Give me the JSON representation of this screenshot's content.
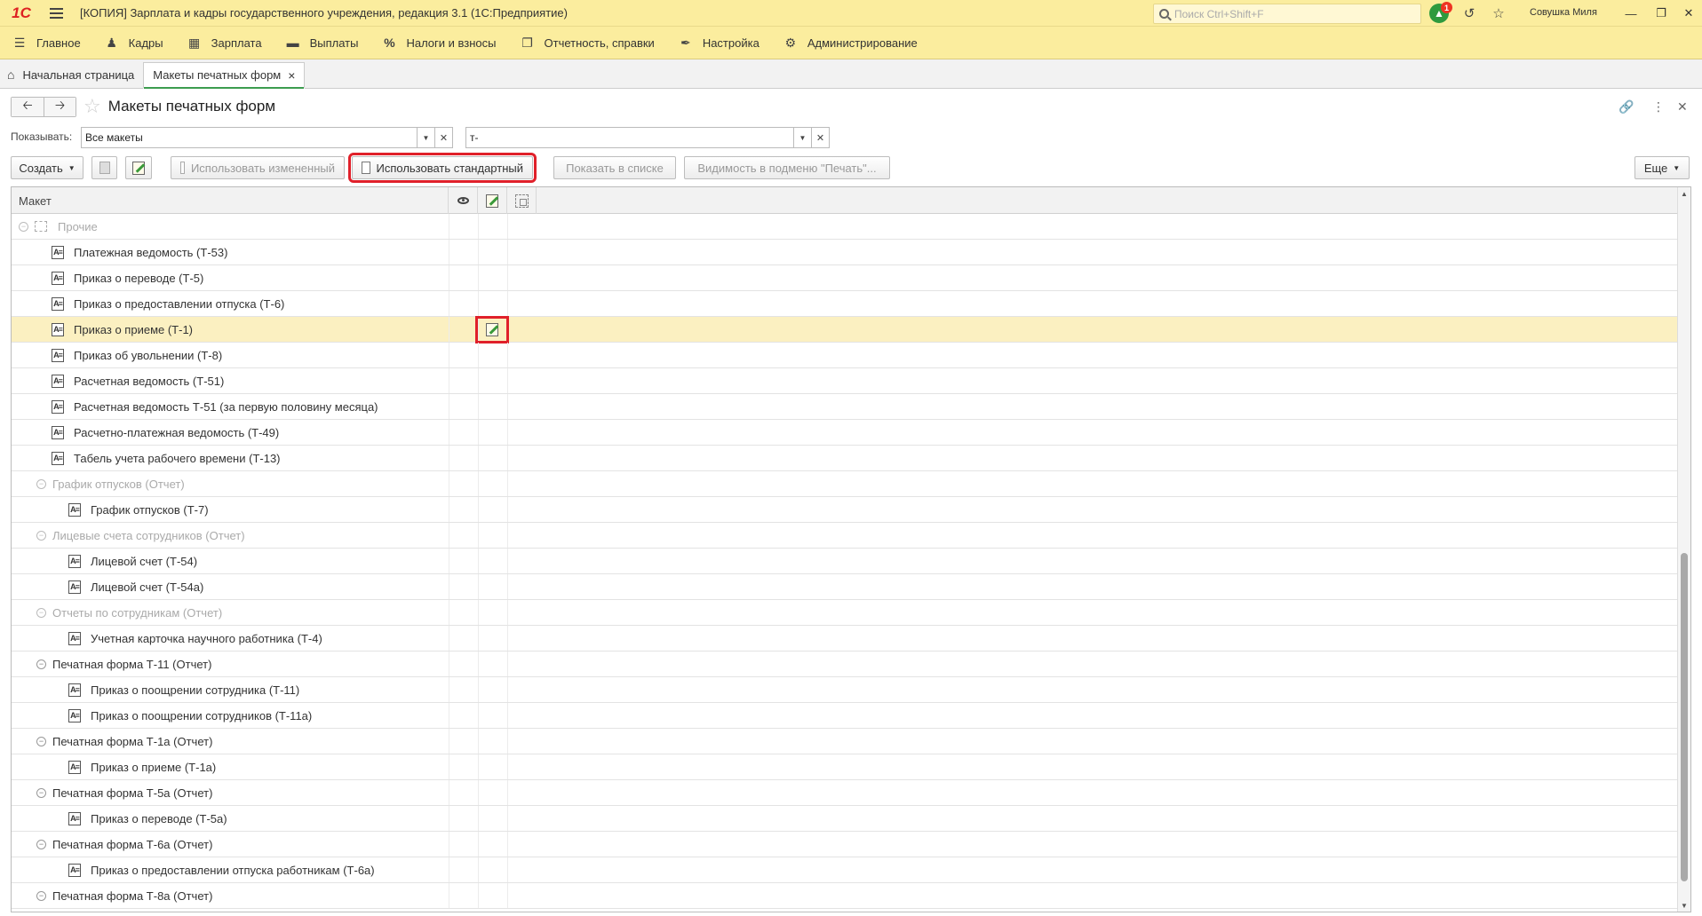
{
  "titlebar": {
    "logo": "1С",
    "title": "[КОПИЯ] Зарплата и кадры государственного учреждения, редакция 3.1  (1С:Предприятие)",
    "search_placeholder": "Поиск Ctrl+Shift+F",
    "notification_count": "1",
    "user": "Совушка Миля"
  },
  "menu": [
    {
      "label": "Главное",
      "icon": "list-icon"
    },
    {
      "label": "Кадры",
      "icon": "people-icon"
    },
    {
      "label": "Зарплата",
      "icon": "calculator-icon"
    },
    {
      "label": "Выплаты",
      "icon": "wallet-icon"
    },
    {
      "label": "Налоги и взносы",
      "icon": "percent-icon"
    },
    {
      "label": "Отчетность, справки",
      "icon": "reports-icon"
    },
    {
      "label": "Настройка",
      "icon": "wrench-icon"
    },
    {
      "label": "Администрирование",
      "icon": "gear-icon"
    }
  ],
  "tabs": {
    "home": "Начальная страница",
    "active": "Макеты печатных форм"
  },
  "form": {
    "title": "Макеты печатных форм",
    "show_label": "Показывать:",
    "show_value": "Все макеты",
    "search_value": "т-"
  },
  "toolbar": {
    "create": "Создать",
    "use_changed": "Использовать измененный",
    "use_standard": "Использовать стандартный",
    "show_in_list": "Показать в списке",
    "visibility": "Видимость в подменю \"Печать\"...",
    "more": "Еще"
  },
  "grid": {
    "column_header": "Макет",
    "rows": [
      {
        "label": "Прочие",
        "level": 0,
        "kind": "root"
      },
      {
        "label": "Платежная ведомость (Т-53)",
        "level": 1,
        "kind": "item"
      },
      {
        "label": "Приказ о переводе (Т-5)",
        "level": 1,
        "kind": "item"
      },
      {
        "label": "Приказ о предоставлении отпуска (Т-6)",
        "level": 1,
        "kind": "item"
      },
      {
        "label": "Приказ о приеме (Т-1)",
        "level": 1,
        "kind": "item",
        "selected": true,
        "edited": true
      },
      {
        "label": "Приказ об увольнении (Т-8)",
        "level": 1,
        "kind": "item"
      },
      {
        "label": "Расчетная ведомость (Т-51)",
        "level": 1,
        "kind": "item"
      },
      {
        "label": "Расчетная ведомость Т-51 (за первую половину месяца)",
        "level": 1,
        "kind": "item"
      },
      {
        "label": "Расчетно-платежная ведомость (Т-49)",
        "level": 1,
        "kind": "item"
      },
      {
        "label": "Табель учета рабочего времени (Т-13)",
        "level": 1,
        "kind": "item"
      },
      {
        "label": "График отпусков (Отчет)",
        "level": 1,
        "kind": "group",
        "dim": true
      },
      {
        "label": "График отпусков (Т-7)",
        "level": 2,
        "kind": "item"
      },
      {
        "label": "Лицевые счета сотрудников (Отчет)",
        "level": 1,
        "kind": "group",
        "dim": true
      },
      {
        "label": "Лицевой счет (Т-54)",
        "level": 2,
        "kind": "item"
      },
      {
        "label": "Лицевой счет (Т-54а)",
        "level": 2,
        "kind": "item"
      },
      {
        "label": "Отчеты по сотрудникам (Отчет)",
        "level": 1,
        "kind": "group",
        "dim": true
      },
      {
        "label": "Учетная карточка научного работника (Т-4)",
        "level": 2,
        "kind": "item"
      },
      {
        "label": "Печатная форма Т-11 (Отчет)",
        "level": 1,
        "kind": "group"
      },
      {
        "label": "Приказ о поощрении сотрудника (Т-11)",
        "level": 2,
        "kind": "item"
      },
      {
        "label": "Приказ о поощрении сотрудников (Т-11а)",
        "level": 2,
        "kind": "item"
      },
      {
        "label": "Печатная форма Т-1а (Отчет)",
        "level": 1,
        "kind": "group"
      },
      {
        "label": "Приказ о приеме (Т-1а)",
        "level": 2,
        "kind": "item"
      },
      {
        "label": "Печатная форма Т-5а (Отчет)",
        "level": 1,
        "kind": "group"
      },
      {
        "label": "Приказ о переводе (Т-5а)",
        "level": 2,
        "kind": "item"
      },
      {
        "label": "Печатная форма Т-6а (Отчет)",
        "level": 1,
        "kind": "group"
      },
      {
        "label": "Приказ о предоставлении отпуска работникам (Т-6а)",
        "level": 2,
        "kind": "item"
      },
      {
        "label": "Печатная форма Т-8а (Отчет)",
        "level": 1,
        "kind": "group"
      }
    ]
  },
  "colors": {
    "title_bar": "#fbed9e",
    "selected_row": "#fbf0c1",
    "highlight": "#e0202a",
    "active_tab_accent": "#3c9d4f"
  }
}
